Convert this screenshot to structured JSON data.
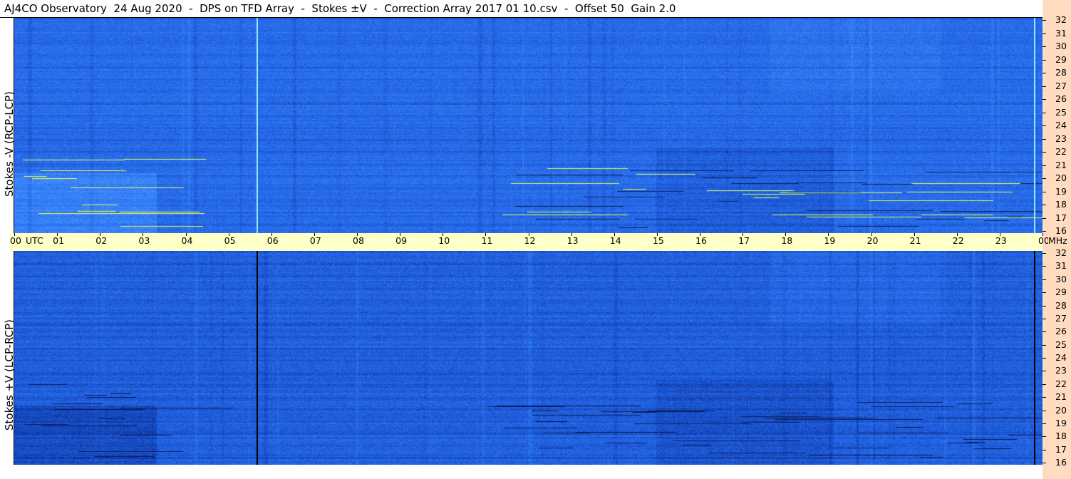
{
  "title": "AJ4CO Observatory  24 Aug 2020  -  DPS on TFD Array  -  Stokes ±V  -  Correction Array 2017 01 10.csv  -  Offset 50  Gain 2.0",
  "chart_data": [
    {
      "type": "heatmap",
      "ylabel": "Stokes -V (RCP-LCP)",
      "x_ticks": [
        "00",
        "01",
        "02",
        "03",
        "04",
        "05",
        "06",
        "07",
        "08",
        "09",
        "10",
        "11",
        "12",
        "13",
        "14",
        "15",
        "16",
        "17",
        "18",
        "19",
        "20",
        "21",
        "22",
        "23",
        "00"
      ],
      "x_unit": "UTC",
      "y_ticks": [
        "32",
        "31",
        "30",
        "29",
        "28",
        "27",
        "26",
        "25",
        "24",
        "23",
        "22",
        "21",
        "20",
        "19",
        "18",
        "17",
        "16"
      ],
      "y_unit": "MHz",
      "xlim": [
        0,
        24
      ],
      "ylim": [
        16,
        32
      ],
      "colormap": [
        "#0a2a8c",
        "#1f5fe0",
        "#3f8cff",
        "#7fd0ff",
        "#e8ff50"
      ],
      "marker_line_color": "#8ee8ff"
    },
    {
      "type": "heatmap",
      "ylabel": "Stokes +V (LCP-RCP)",
      "x_ticks": [
        "00",
        "01",
        "02",
        "03",
        "04",
        "05",
        "06",
        "07",
        "08",
        "09",
        "10",
        "11",
        "12",
        "13",
        "14",
        "15",
        "16",
        "17",
        "18",
        "19",
        "20",
        "21",
        "22",
        "23",
        "00"
      ],
      "x_unit": "UTC",
      "y_ticks": [
        "32",
        "31",
        "30",
        "29",
        "28",
        "27",
        "26",
        "25",
        "24",
        "23",
        "22",
        "21",
        "20",
        "19",
        "18",
        "17",
        "16"
      ],
      "y_unit": "MHz",
      "xlim": [
        0,
        24
      ],
      "ylim": [
        16,
        32
      ],
      "colormap": [
        "#0a2a8c",
        "#1f5fe0",
        "#3f8cff",
        "#7fd0ff",
        "#e8ff50"
      ],
      "marker_line_color": "#000000"
    }
  ],
  "marker_times_utc": [
    5.65,
    23.8
  ]
}
